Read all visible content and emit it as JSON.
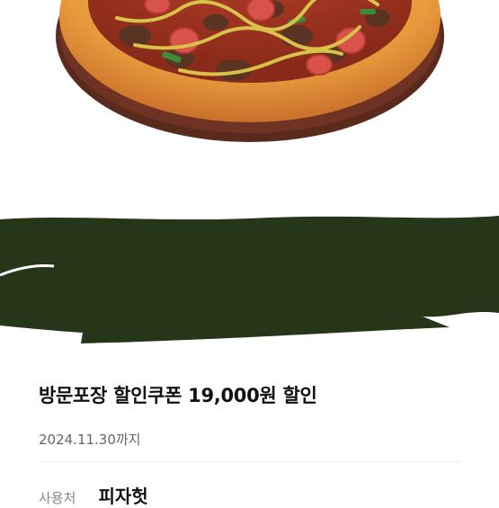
{
  "product": {
    "image": "pizza-photo"
  },
  "coupon": {
    "title": "방문포장 할인쿠폰 19,000원 할인",
    "expiry": "2024.11.30까지",
    "usage_label": "사용처",
    "usage_value": "피자헛"
  },
  "colors": {
    "redaction": "#263618",
    "title": "#111111",
    "expiry": "#666666",
    "label": "#888888"
  }
}
